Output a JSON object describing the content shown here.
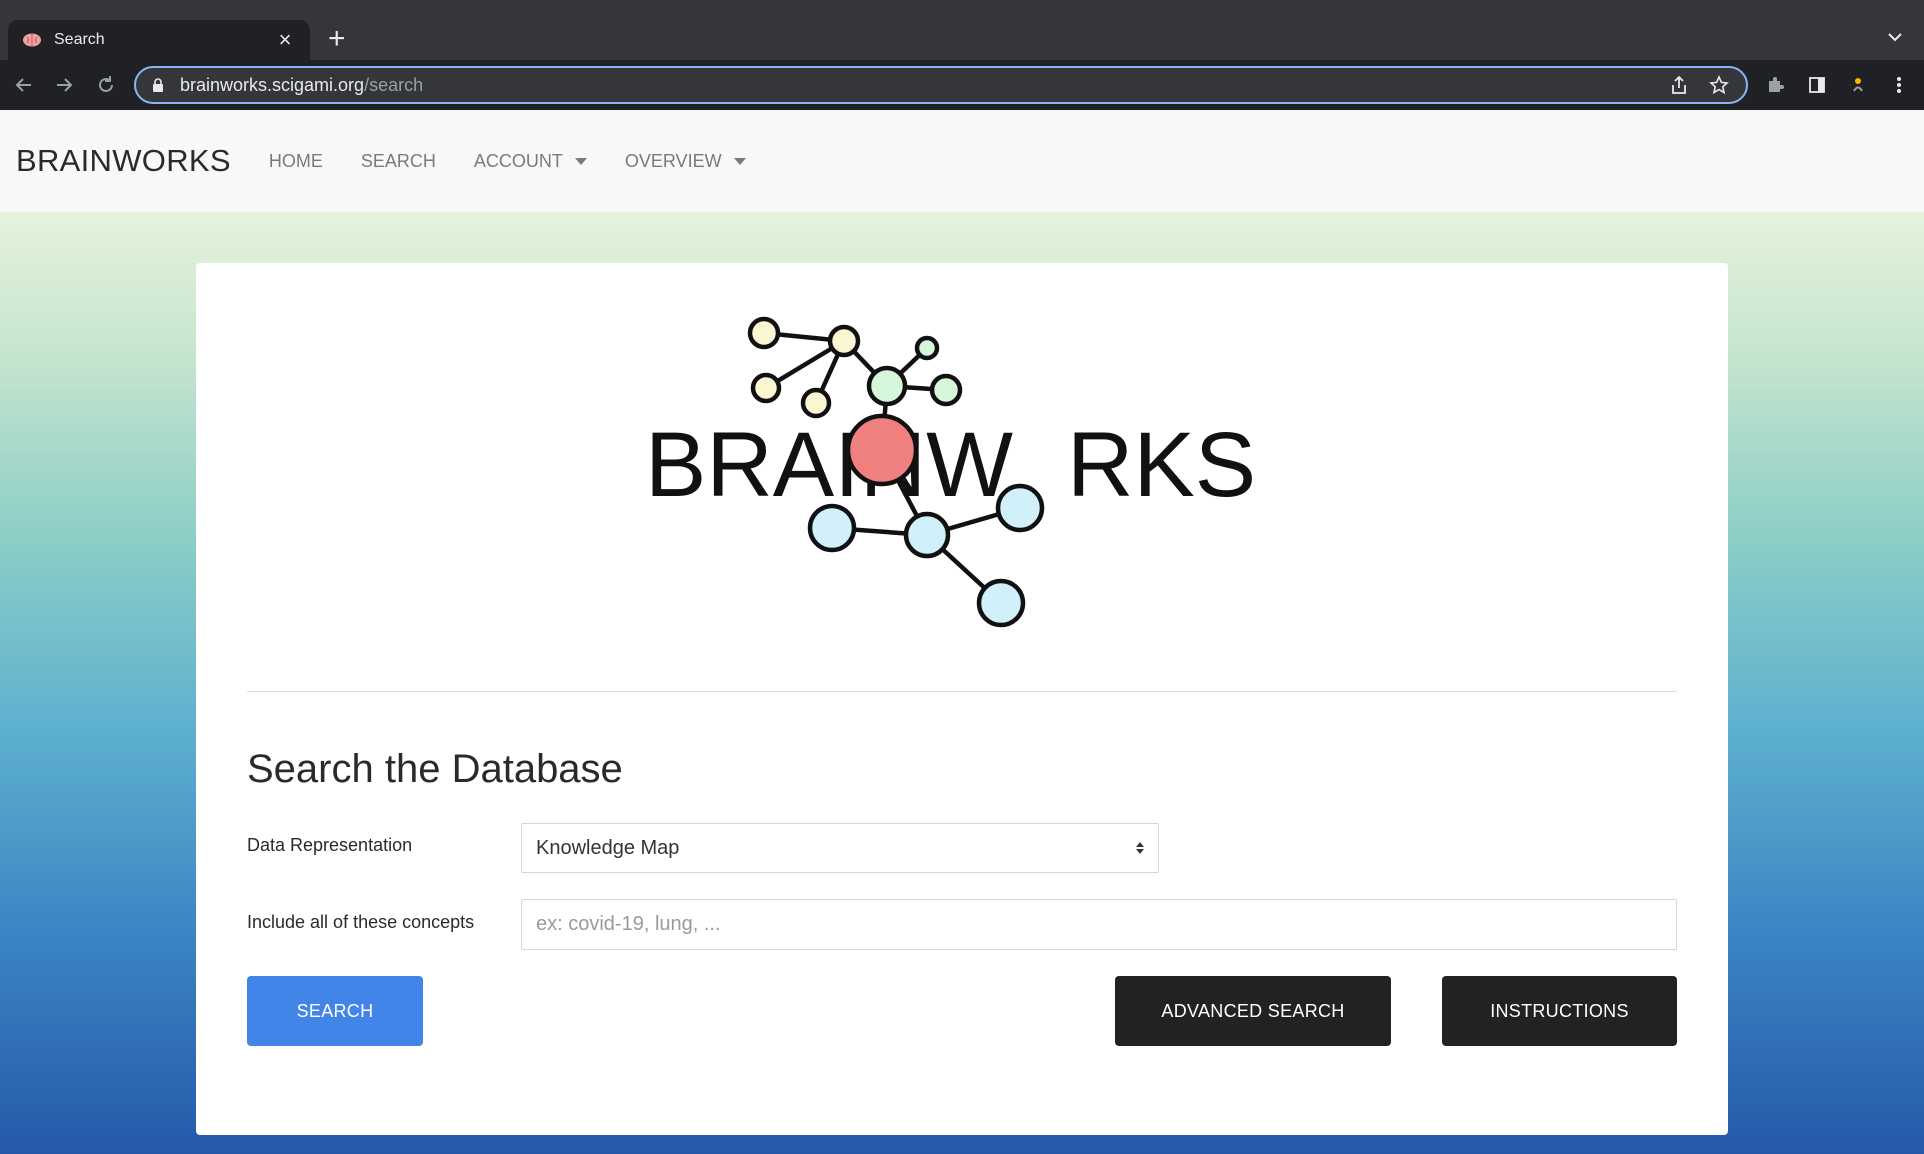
{
  "browser": {
    "tab_title": "Search",
    "tab_icon": "brain-icon",
    "url_host": "brainworks.scigami.org",
    "url_path": "/search"
  },
  "navbar": {
    "brand": "BRAINWORKS",
    "links": [
      "HOME",
      "SEARCH",
      "ACCOUNT",
      "OVERVIEW"
    ]
  },
  "logo": {
    "text_left": "BRAINW",
    "text_right": "RKS",
    "colors": {
      "top_cluster": "#fbf6d2",
      "green": "#d6f6d9",
      "center": "#ef8080",
      "blue": "#d2f0fa"
    }
  },
  "search": {
    "heading": "Search the Database",
    "data_label": "Data Representation",
    "data_value": "Knowledge Map",
    "concepts_label": "Include all of these concepts",
    "concepts_placeholder": "ex: covid-19, lung, ...",
    "search_button": "SEARCH",
    "advanced_button": "ADVANCED SEARCH",
    "instructions_button": "INSTRUCTIONS"
  },
  "colors": {
    "primary": "#4285e8",
    "dark_button": "#222222",
    "omnibox_focus": "#8ab4f8"
  }
}
